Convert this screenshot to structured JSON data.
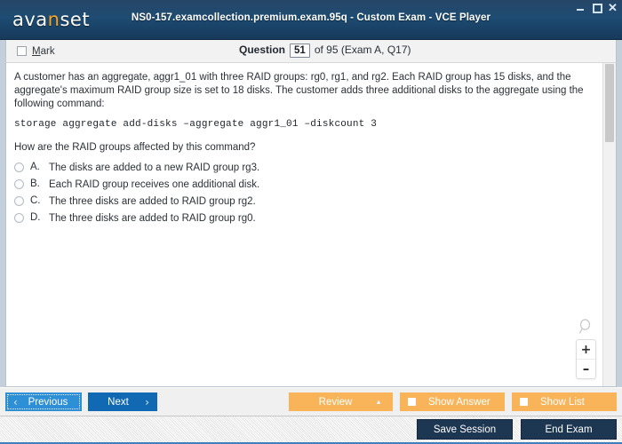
{
  "window": {
    "title": "NS0-157.examcollection.premium.exam.95q - Custom Exam - VCE Player",
    "logo_prefix": "ava",
    "logo_accent": "n",
    "logo_suffix": "set",
    "minimize_label": "Minimize",
    "maximize_label": "Maximize",
    "close_label": "✕",
    "accent_color": "#f5a623",
    "titlebar_color": "#1d4b72"
  },
  "header": {
    "mark_label_accel": "M",
    "mark_label_rest": "ark",
    "question_word": "Question",
    "question_number": "51",
    "question_rest": "of 95 (Exam A, Q17)"
  },
  "question": {
    "body": "A customer has an aggregate, aggr1_01 with three RAID groups: rg0, rg1, and rg2. Each RAID group has 15 disks, and the aggregate's maximum RAID group size is set to 18 disks. The customer adds three additional disks to the aggregate using the following command:",
    "command": "storage aggregate add-disks –aggregate aggr1_01 –diskcount 3",
    "prompt": "How are the RAID groups affected by this command?",
    "options": [
      {
        "letter": "A.",
        "text": "The disks are added to a new RAID group rg3.",
        "selected": false
      },
      {
        "letter": "B.",
        "text": "Each RAID group receives one additional disk.",
        "selected": false
      },
      {
        "letter": "C.",
        "text": "The three disks are added to RAID group rg2.",
        "selected": false
      },
      {
        "letter": "D.",
        "text": "The three disks are added to RAID group rg0.",
        "selected": false
      }
    ]
  },
  "zoom_widget": {
    "magnifier_icon": "magnifier-icon",
    "zoom_in": "+",
    "zoom_out": "–"
  },
  "toolbar": {
    "previous_label": "Previous",
    "previous_chevron": "‹",
    "next_label": "Next",
    "next_chevron": "›",
    "review_label": "Review",
    "review_triangle": "▲",
    "show_answer_label": "Show Answer",
    "show_list_label": "Show List",
    "orange_color": "#f9b45a",
    "blue_color": "#1169b4"
  },
  "statusbar": {
    "save_session_label": "Save Session",
    "end_exam_label": "End Exam"
  }
}
